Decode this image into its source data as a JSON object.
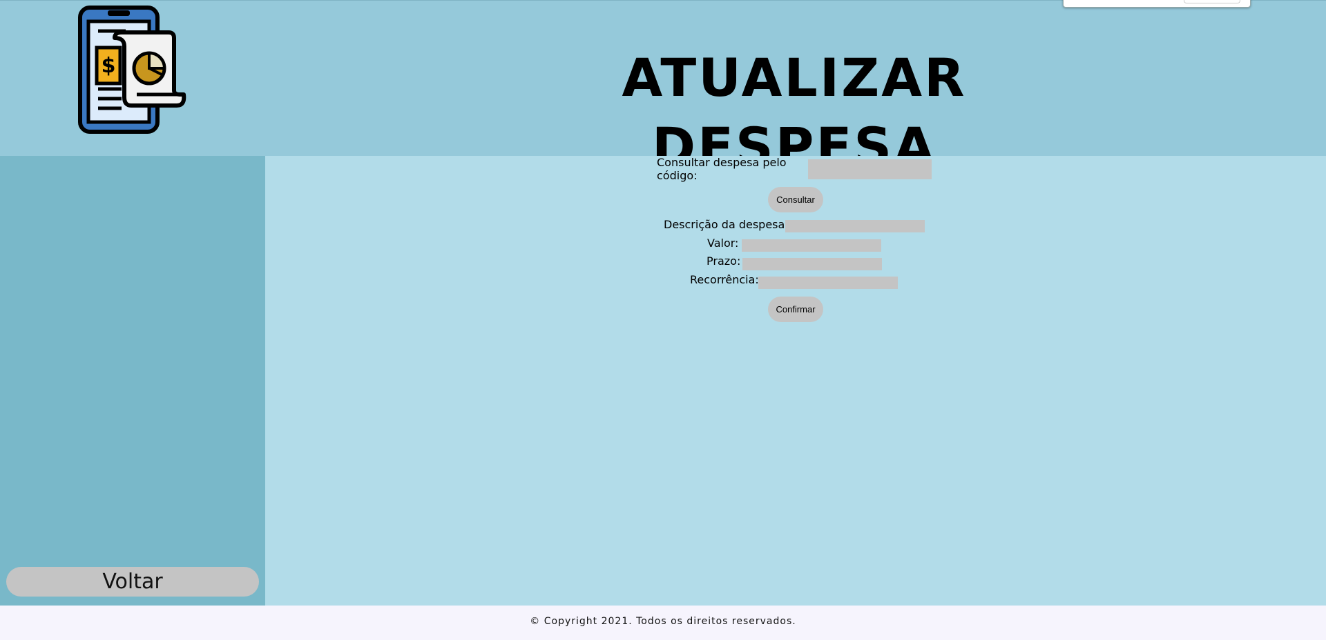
{
  "header": {
    "title": "ATUALIZAR DESPESA",
    "logo_icon": "expense-phone-receipt-icon",
    "logo_dollar": "$"
  },
  "sidebar": {
    "back_label": "Voltar"
  },
  "form": {
    "lookup_label": "Consultar despesa pelo código:",
    "lookup_value": "",
    "consult_button": "Consultar",
    "description_label": "Descrição da despesa:",
    "description_value": "",
    "value_label": "Valor:",
    "value_value": "",
    "deadline_label": "Prazo:",
    "deadline_value": "",
    "recurrence_label": "Recorrência:",
    "recurrence_value": "",
    "confirm_button": "Confirmar"
  },
  "footer": {
    "copyright": "© Copyright 2021. Todos os direitos reservados."
  },
  "colors": {
    "header_bg": "#95c9da",
    "sidebar_bg": "#79b8c9",
    "main_bg": "#b2dce9",
    "control_bg": "#c4c4c4",
    "footer_bg": "#f6f4fd"
  }
}
